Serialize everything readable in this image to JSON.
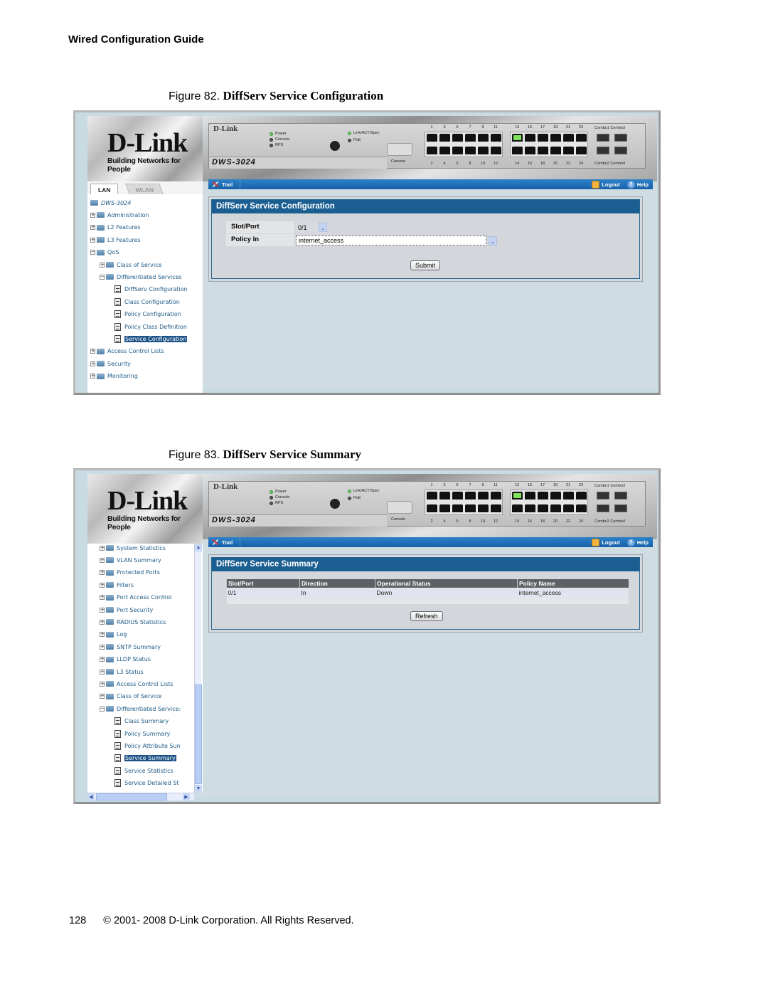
{
  "document": {
    "running_head": "Wired Configuration Guide",
    "page_number": "128",
    "copyright": "© 2001- 2008 D-Link Corporation. All Rights Reserved."
  },
  "figures": [
    {
      "label": "Figure 82.",
      "title": "DiffServ Service Configuration",
      "app": {
        "logo": "D-Link",
        "tagline": "Building Networks for People",
        "tabs": [
          "LAN",
          "WLAN"
        ],
        "active_tab": "LAN",
        "device": {
          "brand": "D-Link",
          "model": "DWS-3024",
          "leds": [
            "Power",
            "Console",
            "RPS",
            "Link/ACT/Spec",
            "PoE"
          ],
          "console_label": "Console",
          "ports_top": [
            "1",
            "3",
            "5",
            "7",
            "9",
            "11",
            "13",
            "15",
            "17",
            "19",
            "21",
            "23"
          ],
          "ports_bottom": [
            "2",
            "4",
            "6",
            "8",
            "10",
            "12",
            "14",
            "16",
            "18",
            "20",
            "22",
            "24"
          ],
          "active_port": "13",
          "combo_labels": [
            "Combo1 Combo3",
            "Combo2 Combo4"
          ]
        },
        "toolbar": {
          "tool": "Tool",
          "logout": "Logout",
          "help": "Help"
        },
        "tree": [
          {
            "label": "DWS-3024",
            "level": 0,
            "type": "root"
          },
          {
            "label": "Administration",
            "level": 0,
            "type": "folder",
            "toggle": "+"
          },
          {
            "label": "L2 Features",
            "level": 0,
            "type": "folder",
            "toggle": "+"
          },
          {
            "label": "L3 Features",
            "level": 0,
            "type": "folder",
            "toggle": "+"
          },
          {
            "label": "QoS",
            "level": 0,
            "type": "folder-open",
            "toggle": "-"
          },
          {
            "label": "Class of Service",
            "level": 1,
            "type": "folder",
            "toggle": "+"
          },
          {
            "label": "Differentiated Services",
            "level": 1,
            "type": "folder-open",
            "toggle": "-"
          },
          {
            "label": "DiffServ Configuration",
            "level": 2,
            "type": "page"
          },
          {
            "label": "Class Configuration",
            "level": 2,
            "type": "page"
          },
          {
            "label": "Policy Configuration",
            "level": 2,
            "type": "page"
          },
          {
            "label": "Policy Class Definition",
            "level": 2,
            "type": "page"
          },
          {
            "label": "Service Configuration",
            "level": 2,
            "type": "page",
            "selected": true
          },
          {
            "label": "Access Control Lists",
            "level": 0,
            "type": "folder",
            "toggle": "+"
          },
          {
            "label": "Security",
            "level": 0,
            "type": "folder",
            "toggle": "+"
          },
          {
            "label": "Monitoring",
            "level": 0,
            "type": "folder",
            "toggle": "+"
          }
        ],
        "panel": {
          "title": "DiffServ Service Configuration",
          "fields": [
            {
              "label": "Slot/Port",
              "value": "0/1"
            },
            {
              "label": "Policy In",
              "value": "internet_access"
            }
          ],
          "submit": "Submit"
        }
      }
    },
    {
      "label": "Figure 83.",
      "title": "DiffServ Service Summary",
      "app": {
        "logo": "D-Link",
        "tagline": "Building Networks for People",
        "device": {
          "brand": "D-Link",
          "model": "DWS-3024",
          "leds": [
            "Power",
            "Console",
            "RPS",
            "Link/ACT/Spec",
            "PoE"
          ],
          "console_label": "Console",
          "ports_top": [
            "1",
            "3",
            "5",
            "7",
            "9",
            "11",
            "13",
            "15",
            "17",
            "19",
            "21",
            "23"
          ],
          "ports_bottom": [
            "2",
            "4",
            "6",
            "8",
            "10",
            "12",
            "14",
            "16",
            "18",
            "20",
            "22",
            "24"
          ],
          "active_port": "13",
          "combo_labels": [
            "Combo1 Combo3",
            "Combo2 Combo4"
          ]
        },
        "toolbar": {
          "tool": "Tool",
          "logout": "Logout",
          "help": "Help"
        },
        "tree": [
          {
            "label": "System Statistics",
            "level": 1,
            "type": "folder",
            "toggle": "+"
          },
          {
            "label": "VLAN Summary",
            "level": 1,
            "type": "folder",
            "toggle": "+"
          },
          {
            "label": "Protected Ports",
            "level": 1,
            "type": "folder",
            "toggle": "+"
          },
          {
            "label": "Filters",
            "level": 1,
            "type": "folder",
            "toggle": "+"
          },
          {
            "label": "Port Access Control",
            "level": 1,
            "type": "folder",
            "toggle": "+"
          },
          {
            "label": "Port Security",
            "level": 1,
            "type": "folder",
            "toggle": "+"
          },
          {
            "label": "RADIUS Statistics",
            "level": 1,
            "type": "folder",
            "toggle": "+"
          },
          {
            "label": "Log",
            "level": 1,
            "type": "folder",
            "toggle": "+"
          },
          {
            "label": "SNTP Summary",
            "level": 1,
            "type": "folder",
            "toggle": "+"
          },
          {
            "label": "LLDP Status",
            "level": 1,
            "type": "folder",
            "toggle": "+"
          },
          {
            "label": "L3 Status",
            "level": 1,
            "type": "folder",
            "toggle": "+"
          },
          {
            "label": "Access Control Lists",
            "level": 1,
            "type": "folder",
            "toggle": "+"
          },
          {
            "label": "Class of Service",
            "level": 1,
            "type": "folder",
            "toggle": "+"
          },
          {
            "label": "Differentiated Service:",
            "level": 1,
            "type": "folder-open",
            "toggle": "-"
          },
          {
            "label": "Class Summary",
            "level": 2,
            "type": "page"
          },
          {
            "label": "Policy Summary",
            "level": 2,
            "type": "page"
          },
          {
            "label": "Policy Attribute Sun",
            "level": 2,
            "type": "page"
          },
          {
            "label": "Service Summary",
            "level": 2,
            "type": "page",
            "selected": true
          },
          {
            "label": "Service Statistics",
            "level": 2,
            "type": "page"
          },
          {
            "label": "Service Detailed St",
            "level": 2,
            "type": "page"
          }
        ],
        "panel": {
          "title": "DiffServ Service Summary",
          "columns": [
            "Slot/Port",
            "Direction",
            "Operational Status",
            "Policy Name"
          ],
          "rows": [
            [
              "0/1",
              "In",
              "Down",
              "internet_access"
            ]
          ],
          "refresh": "Refresh"
        }
      }
    }
  ]
}
